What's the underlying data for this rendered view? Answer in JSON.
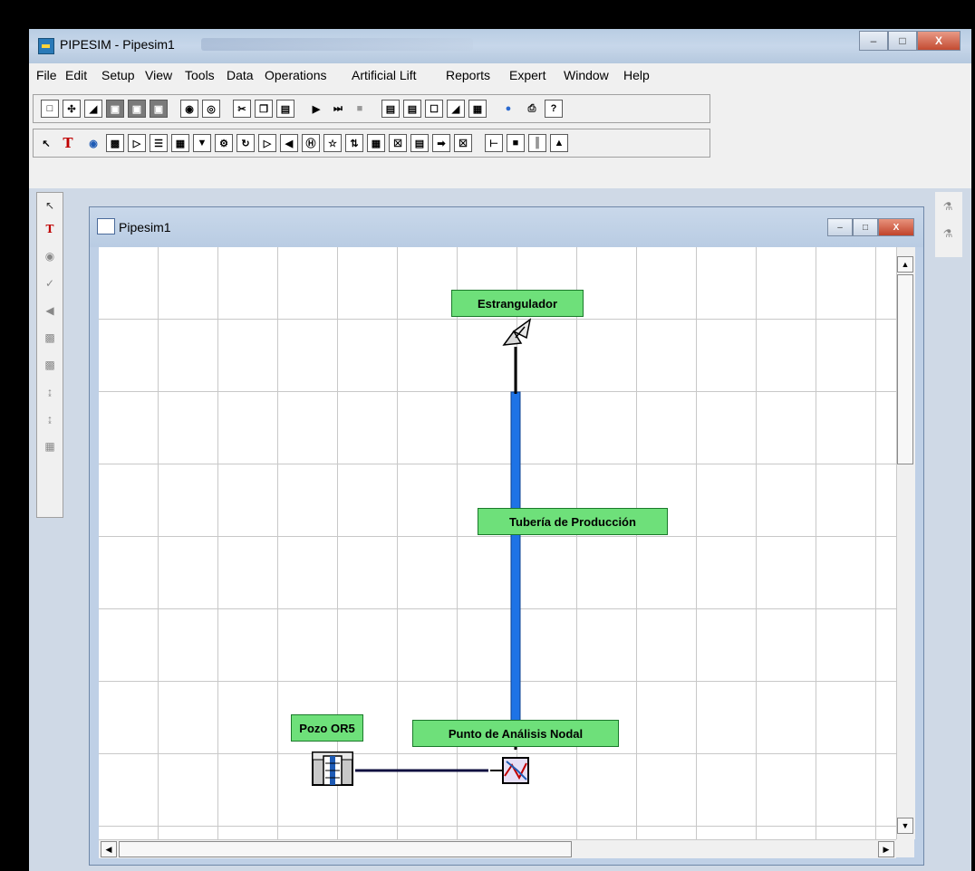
{
  "app": {
    "title": "PIPESIM - Pipesim1"
  },
  "menu": [
    "File",
    "Edit",
    "Setup",
    "View",
    "Tools",
    "Data",
    "Operations",
    "Artificial Lift",
    "Reports",
    "Expert",
    "Window",
    "Help"
  ],
  "document": {
    "title": "Pipesim1"
  },
  "diagram": {
    "labels": {
      "choke": "Estrangulador",
      "tubing": "Tubería de Producción",
      "nodal_point": "Punto de Análisis Nodal",
      "well": "Pozo OR5"
    },
    "colors": {
      "label_bg": "#6ee07a",
      "tubing": "#1e73e6",
      "flowline": "#101040"
    }
  }
}
